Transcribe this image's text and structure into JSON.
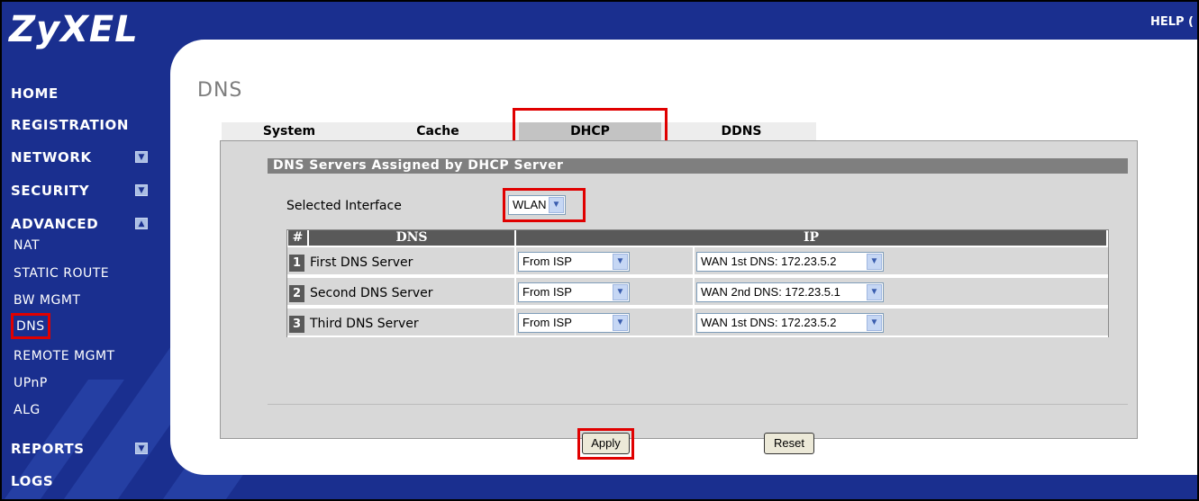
{
  "header": {
    "logo": "ZyXEL",
    "help": "HELP ("
  },
  "sidebar": {
    "home": "HOME",
    "registration": "REGISTRATION",
    "network": "NETWORK",
    "security": "SECURITY",
    "advanced": "ADVANCED",
    "advanced_items": [
      "NAT",
      "STATIC ROUTE",
      "BW MGMT",
      "DNS",
      "REMOTE MGMT",
      "UPnP",
      "ALG"
    ],
    "reports": "REPORTS",
    "logs": "LOGS"
  },
  "main": {
    "title": "DNS",
    "tabs": [
      "System",
      "Cache",
      "DHCP",
      "DDNS"
    ],
    "active_tab": "DHCP",
    "section_title": "DNS Servers Assigned by DHCP Server",
    "selected_interface_label": "Selected Interface",
    "selected_interface_value": "WLAN",
    "table": {
      "headers": [
        "#",
        "DNS",
        "IP"
      ],
      "rows": [
        {
          "num": "1",
          "name": "First DNS Server",
          "source": "From ISP",
          "ip": "WAN 1st DNS: 172.23.5.2"
        },
        {
          "num": "2",
          "name": "Second DNS Server",
          "source": "From ISP",
          "ip": "WAN 2nd DNS: 172.23.5.1"
        },
        {
          "num": "3",
          "name": "Third DNS Server",
          "source": "From ISP",
          "ip": "WAN 1st DNS: 172.23.5.2"
        }
      ]
    },
    "apply_label": "Apply",
    "reset_label": "Reset"
  },
  "colors": {
    "background": "#1a2f8f",
    "highlight": "#e00000",
    "panel": "#d8d8d8",
    "header_cell": "#595959"
  }
}
